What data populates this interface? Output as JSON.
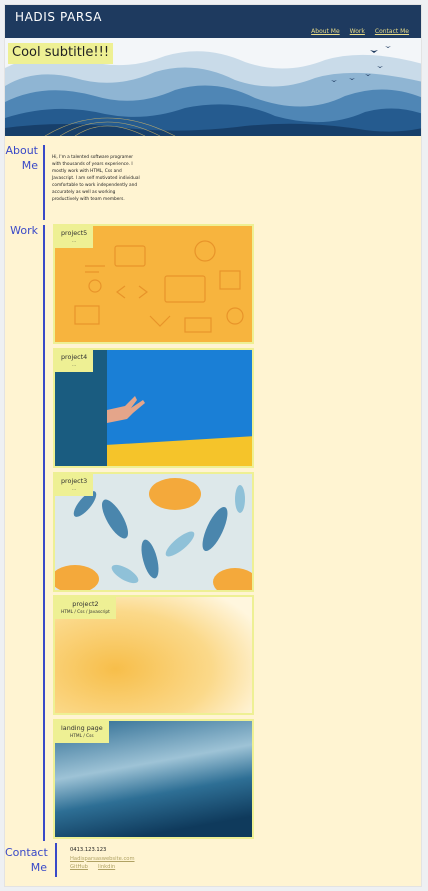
{
  "header": {
    "brand": "HADIS PARSA",
    "nav": [
      "About Me",
      "Work",
      "Contact Me"
    ]
  },
  "hero": {
    "subtitle": "Cool subtitle!!!"
  },
  "about": {
    "title_line1": "About",
    "title_line2": "Me",
    "text": "Hi, I'm a talented software programer with thousands of years experience. I mostly work with HTML, Css and Javascript. I am self motivated individual comfortable to work independently and accurately as well as working productively with team members."
  },
  "work": {
    "title": "Work",
    "projects": [
      {
        "title": "project5",
        "desc": "..."
      },
      {
        "title": "project4",
        "desc": "..."
      },
      {
        "title": "project3",
        "desc": "..."
      },
      {
        "title": "project2",
        "desc": "HTML / Css / Javascript"
      },
      {
        "title": "landing page",
        "desc": "HTML / Css"
      }
    ]
  },
  "contact": {
    "title_line1": "Contact",
    "title_line2": "Me",
    "phone": "0413.123.123",
    "email": "Hadisparsaswebsite.com",
    "links": [
      "GitHub",
      "linkdin"
    ]
  },
  "colors": {
    "header": "#1e3a5f",
    "page_bg": "#fff4d2",
    "accent_blue": "#3949c8",
    "label_yellow": "#eef094",
    "link_gold": "#e9dc88"
  }
}
